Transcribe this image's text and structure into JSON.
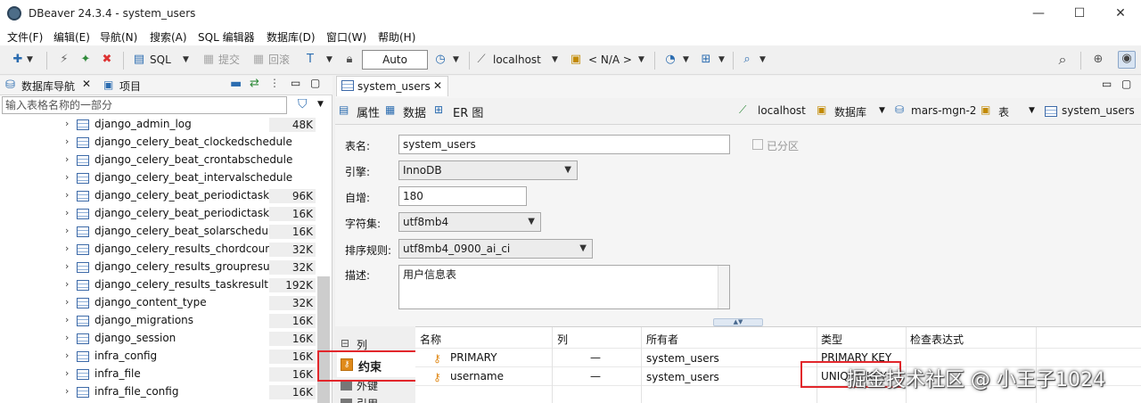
{
  "window": {
    "title": "DBeaver 24.3.4 - system_users",
    "minimize": "—",
    "maximize": "☐",
    "close": "✕"
  },
  "menu": [
    "文件(F)",
    "编辑(E)",
    "导航(N)",
    "搜索(A)",
    "SQL 编辑器",
    "数据库(D)",
    "窗口(W)",
    "帮助(H)"
  ],
  "toolbar": {
    "sql": "SQL",
    "commit": "提交",
    "rollback": "回滚",
    "mode": "Auto",
    "connection": "localhost",
    "schema": "< N/A >"
  },
  "left": {
    "tab_navigator": "数据库导航",
    "tab_projects": "项目",
    "filter_placeholder": "输入表格名称的一部分",
    "tables": [
      {
        "name": "django_admin_log",
        "size": "48K"
      },
      {
        "name": "django_celery_beat_clockedschedule",
        "size": ""
      },
      {
        "name": "django_celery_beat_crontabschedule",
        "size": ""
      },
      {
        "name": "django_celery_beat_intervalschedule",
        "size": ""
      },
      {
        "name": "django_celery_beat_periodictask",
        "size": "96K"
      },
      {
        "name": "django_celery_beat_periodictasks",
        "size": "16K"
      },
      {
        "name": "django_celery_beat_solarschedule",
        "size": "16K"
      },
      {
        "name": "django_celery_results_chordcounter",
        "size": "32K"
      },
      {
        "name": "django_celery_results_groupresult",
        "size": "32K"
      },
      {
        "name": "django_celery_results_taskresult",
        "size": "192K"
      },
      {
        "name": "django_content_type",
        "size": "32K"
      },
      {
        "name": "django_migrations",
        "size": "16K"
      },
      {
        "name": "django_session",
        "size": "16K"
      },
      {
        "name": "infra_config",
        "size": "16K"
      },
      {
        "name": "infra_file",
        "size": "16K"
      },
      {
        "name": "infra_file_config",
        "size": "16K"
      }
    ]
  },
  "editor": {
    "tab_title": "system_users",
    "subtabs": [
      "属性",
      "数据",
      "ER 图"
    ],
    "breadcrumb": [
      "localhost",
      "数据库",
      "mars-mgn-2",
      "表",
      "system_users"
    ]
  },
  "props": {
    "table_name_label": "表名:",
    "table_name": "system_users",
    "partitioned_label": "已分区",
    "engine_label": "引擎:",
    "engine": "InnoDB",
    "auto_inc_label": "自增:",
    "auto_inc": "180",
    "charset_label": "字符集:",
    "charset": "utf8mb4",
    "collation_label": "排序规则:",
    "collation": "utf8mb4_0900_ai_ci",
    "desc_label": "描述:",
    "desc": "用户信息表"
  },
  "sections": [
    "列",
    "约束",
    "外键",
    "引用"
  ],
  "constraints": {
    "headers": [
      "名称",
      "列",
      "所有者",
      "类型",
      "检查表达式"
    ],
    "rows": [
      {
        "name": "PRIMARY",
        "col": "—",
        "owner": "system_users",
        "type": "PRIMARY KEY"
      },
      {
        "name": "username",
        "col": "—",
        "owner": "system_users",
        "type": "UNIQUE KEY"
      }
    ]
  },
  "watermark": "掘金技术社区 @ 小王子1024"
}
